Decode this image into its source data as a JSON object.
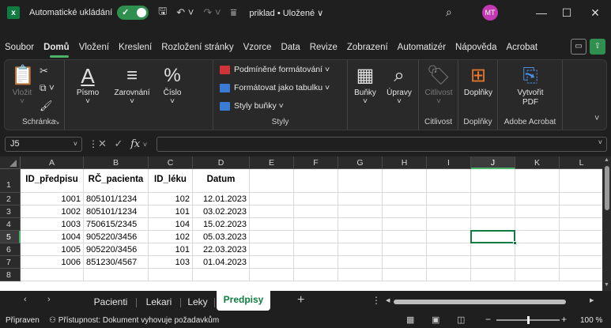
{
  "titlebar": {
    "app_icon_letter": "x",
    "autosave_label": "Automatické ukládání",
    "filename": "priklad • Uložené ∨",
    "avatar_initials": "MT"
  },
  "menu": {
    "items": [
      "Soubor",
      "Domů",
      "Vložení",
      "Kreslení",
      "Rozložení stránky",
      "Vzorce",
      "Data",
      "Revize",
      "Zobrazení",
      "Automatizér",
      "Nápověda",
      "Acrobat"
    ],
    "active": "Domů"
  },
  "ribbon": {
    "clipboard": {
      "paste": "Vložit",
      "label": "Schránka"
    },
    "font": {
      "label": "Písmo"
    },
    "alignment": {
      "label": "Zarovnání"
    },
    "number": {
      "label": "Číslo"
    },
    "styles": {
      "conditional": "Podmíněné formátování ˅",
      "format_table": "Formátovat jako tabulku ˅",
      "cell_styles": "Styly buňky ˅",
      "label": "Styly"
    },
    "cells": {
      "label": "Buňky"
    },
    "editing": {
      "label": "Úpravy"
    },
    "sensitivity": {
      "label": "Citlivost",
      "group": "Citlivost"
    },
    "addins": {
      "label": "Doplňky",
      "group": "Doplňky"
    },
    "acrobat": {
      "label": "Vytvořit PDF",
      "group": "Adobe Acrobat"
    }
  },
  "formula_bar": {
    "name_box": "J5",
    "fx": "fx",
    "content": ""
  },
  "sheet": {
    "columns": [
      "A",
      "B",
      "C",
      "D",
      "E",
      "F",
      "G",
      "H",
      "I",
      "J",
      "K",
      "L"
    ],
    "selected_column": "J",
    "rows": [
      "1",
      "2",
      "3",
      "4",
      "5",
      "6",
      "7",
      "8"
    ],
    "selected_row": "5",
    "headers": [
      "ID_předpisu",
      "RČ_pacienta",
      "ID_léku",
      "Datum"
    ],
    "data": [
      [
        "1001",
        "805101/1234",
        "102",
        "12.01.2023"
      ],
      [
        "1002",
        "805101/1234",
        "101",
        "03.02.2023"
      ],
      [
        "1003",
        "750615/2345",
        "104",
        "15.02.2023"
      ],
      [
        "1004",
        "905220/3456",
        "102",
        "05.03.2023"
      ],
      [
        "1005",
        "905220/3456",
        "101",
        "22.03.2023"
      ],
      [
        "1006",
        "851230/4567",
        "103",
        "01.04.2023"
      ]
    ]
  },
  "sheet_tabs": {
    "tabs": [
      "Pacienti",
      "Lekari",
      "Leky",
      "Predpisy"
    ],
    "active": "Predpisy",
    "add": "+"
  },
  "statusbar": {
    "ready": "Připraven",
    "accessibility": "Přístupnost: Dokument vyhovuje požadavkům",
    "zoom": "100 %"
  },
  "colors": {
    "excel_green": "#107c41",
    "accent_green": "#4bb36a",
    "ribbon_bg": "#292929",
    "window_bg": "#1f1f1f"
  }
}
